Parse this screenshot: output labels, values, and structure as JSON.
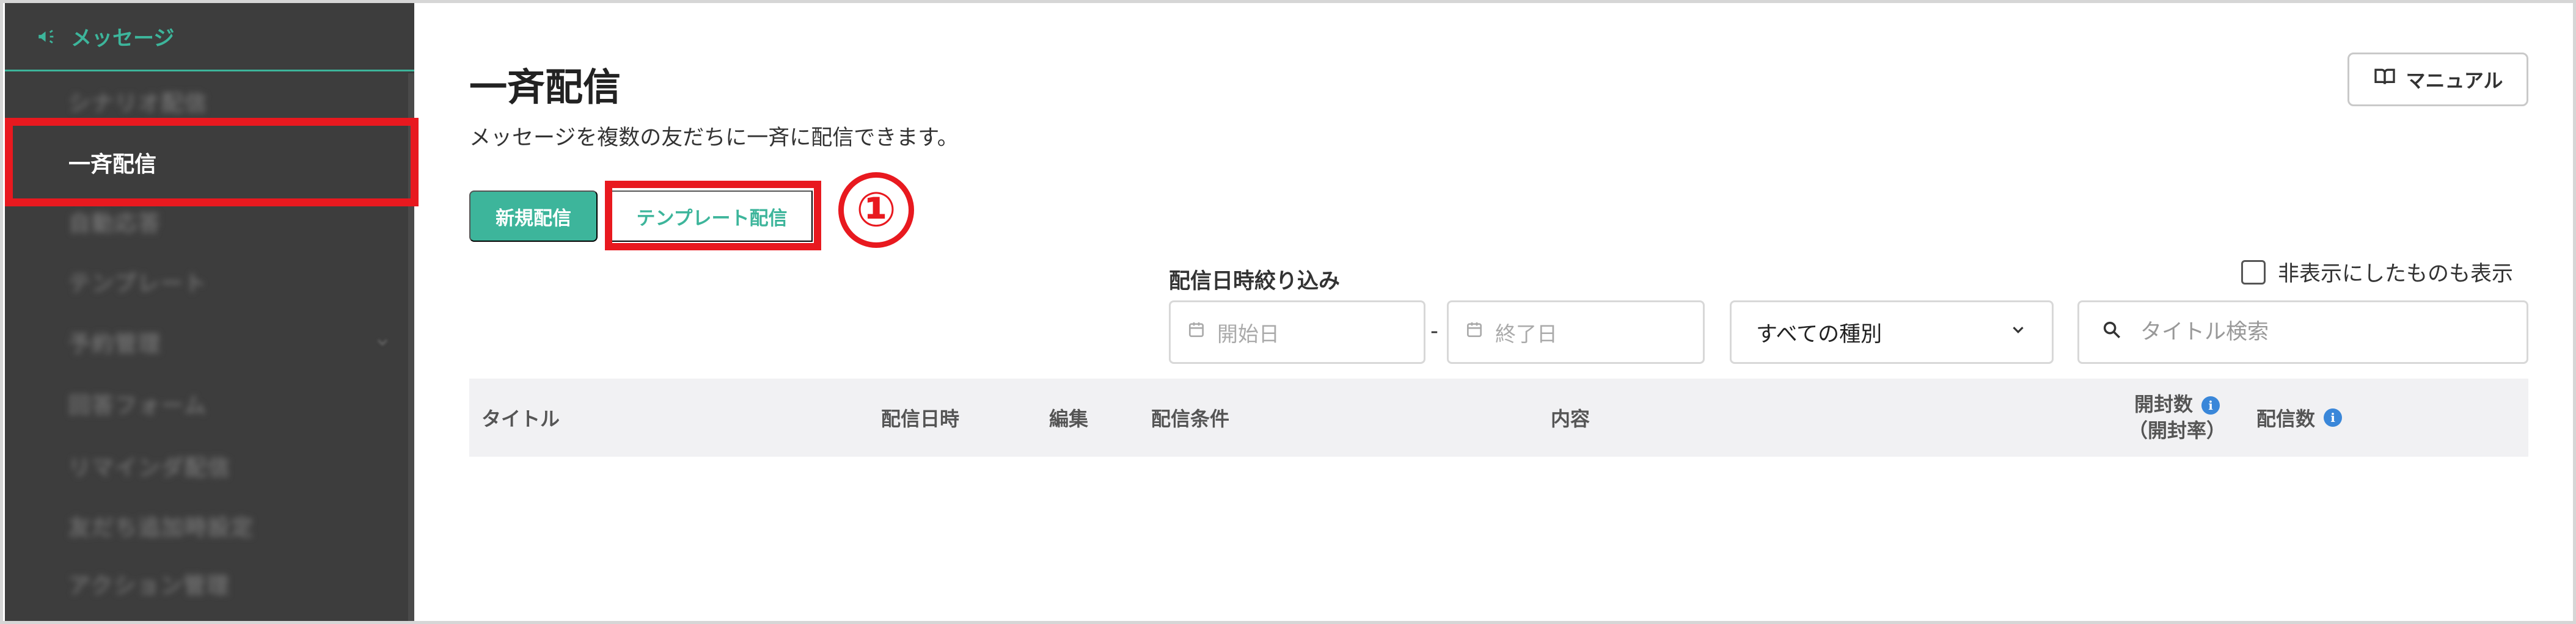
{
  "sidebar": {
    "section_label": "メッセージ",
    "items": [
      {
        "label": "シナリオ配信"
      },
      {
        "label": "一斉配信"
      },
      {
        "label": "自動応答"
      },
      {
        "label": "テンプレート"
      },
      {
        "label": "予約管理"
      },
      {
        "label": "回答フォーム"
      },
      {
        "label": "リマインダ配信"
      },
      {
        "label": "友だち追加時設定"
      },
      {
        "label": "アクション管理"
      }
    ]
  },
  "page": {
    "title": "一斉配信",
    "subtitle": "メッセージを複数の友だちに一斉に配信できます。",
    "manual_label": "マニュアル"
  },
  "actions": {
    "new_label": "新規配信",
    "template_label": "テンプレート配信",
    "step_marker": "①"
  },
  "filters": {
    "date_label": "配信日時絞り込み",
    "start_placeholder": "開始日",
    "end_placeholder": "終了日",
    "separator": "-",
    "type_value": "すべての種別",
    "search_placeholder": "タイトル検索",
    "show_hidden_label": "非表示にしたものも表示",
    "show_hidden_checked": false
  },
  "table": {
    "columns": {
      "title": "タイトル",
      "date": "配信日時",
      "edit": "編集",
      "conditions": "配信条件",
      "content": "内容",
      "opened": "開封数",
      "open_rate": "（開封率）",
      "delivered": "配信数"
    },
    "info_glyph": "i"
  },
  "colors": {
    "accent": "#3db59b",
    "sidebar_bg": "#3d3d3d",
    "highlight": "#e8191f",
    "info": "#3a87d9"
  }
}
